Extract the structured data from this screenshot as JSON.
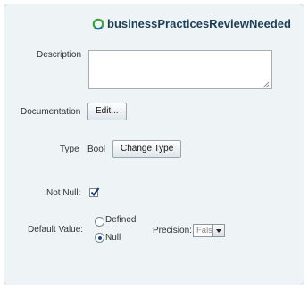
{
  "header": {
    "icon": "green-cycle-icon",
    "title": "businessPracticesReviewNeeded"
  },
  "form": {
    "description_label": "Description",
    "description_value": "",
    "documentation_label": "Documentation",
    "documentation_button": "Edit...",
    "type_label": "Type",
    "type_value": "Bool",
    "change_type_button": "Change Type",
    "not_null_label": "Not Null:",
    "not_null_checked": true,
    "default_value_label": "Default Value:",
    "default_options": [
      "Defined",
      "Null"
    ],
    "default_selected": "Null",
    "precision_label": "Precision:",
    "precision_value": "False"
  },
  "colors": {
    "panel_bg": "#eef3f5",
    "title_text": "#1c3f57",
    "accent": "#1a4b8a"
  }
}
